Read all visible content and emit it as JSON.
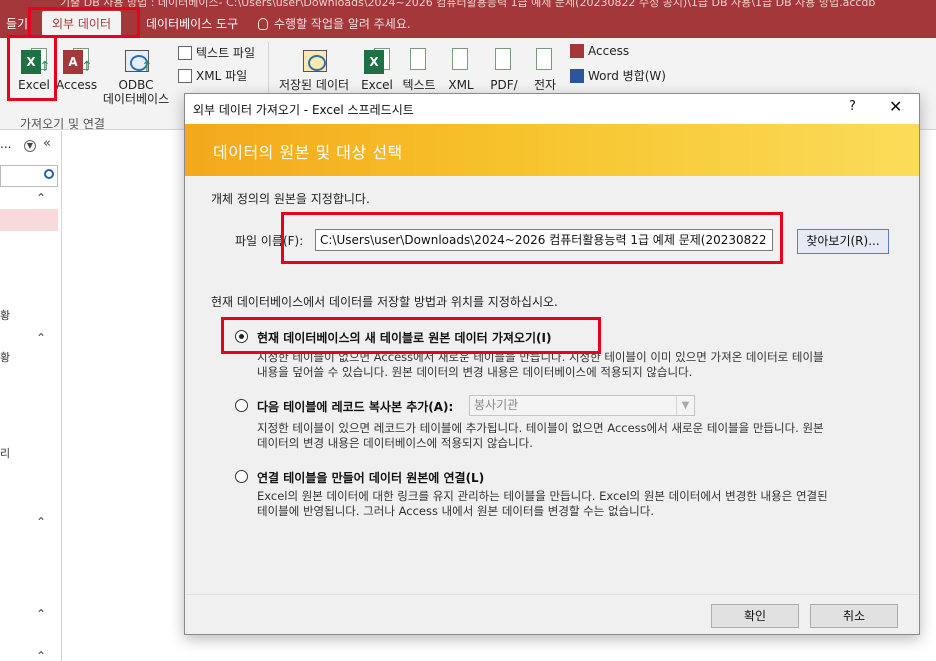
{
  "window": {
    "title_fragment": "기출 DB 사용 방법 : 데이터베이스- C:\\Users\\user\\Downloads\\2024~2026 컴퓨터활용능력 1급 예제 문제(20230822 수정 공지)\\1급 DB 사용\\1급 DB 사용 방법.accdb"
  },
  "ribbon": {
    "tabs": [
      {
        "label": "들기"
      },
      {
        "label": "외부 데이터"
      },
      {
        "label": "데이터베이스 도구"
      }
    ],
    "tell_me": "수행할 작업을 알려 주세요.",
    "import_group": {
      "label": "가져오기 및 연결",
      "excel": "Excel",
      "access": "Access",
      "odbc_line1": "ODBC",
      "odbc_line2": "데이터베이스",
      "text_file": "텍스트 파일",
      "xml_file": "XML 파일"
    },
    "export_group": {
      "saved": "저장된 데이터",
      "excel": "Excel",
      "text": "텍스트",
      "xml": "XML",
      "pdf": "PDF/",
      "email": "전자",
      "access": "Access",
      "word_merge": "Word 병합(W)"
    }
  },
  "nav": {
    "dots": "...",
    "collapse": "«",
    "chev": "⌃",
    "frag1": "황",
    "frag2": "황",
    "frag3": "리"
  },
  "dialog": {
    "title": "외부 데이터 가져오기 - Excel 스프레드시트",
    "help": "?",
    "close": "✕",
    "banner": "데이터의 원본 및 대상 선택",
    "specify_source": "개체 정의의 원본을 지정합니다.",
    "file_name_label": "파일 이름(F):",
    "file_path": "C:\\Users\\user\\Downloads\\2024~2026 컴퓨터활용능력 1급 예제 문제(20230822",
    "browse": "찾아보기(R)...",
    "specify_storage": "현재 데이터베이스에서 데이터를 저장할 방법과 위치를 지정하십시오.",
    "options": [
      {
        "label": "현재 데이터베이스의 새 테이블로 원본 데이터 가져오기(I)",
        "selected": true,
        "desc1": "지정한 테이블이 없으면 Access에서 새로운 테이블을 만듭니다. 지정한 테이블이 이미 있으면 가져온 데이터로 테이블",
        "desc2": "내용을 덮어쓸 수 있습니다. 원본 데이터의 변경 내용은 데이터베이스에 적용되지 않습니다."
      },
      {
        "label": "다음 테이블에 레코드 복사본 추가(A):",
        "selected": false,
        "combo_value": "봉사기관",
        "desc1": "지정한 테이블이 있으면 레코드가 테이블에 추가됩니다. 테이블이 없으면 Access에서 새로운 테이블을 만듭니다. 원본",
        "desc2": "데이터의 변경 내용은 데이터베이스에 적용되지 않습니다."
      },
      {
        "label": "연결 테이블을 만들어 데이터 원본에 연결(L)",
        "selected": false,
        "desc1": "Excel의 원본 데이터에 대한 링크를 유지 관리하는 테이블을 만듭니다. Excel의 원본 데이터에서 변경한 내용은 연결된",
        "desc2": "테이블에 반영됩니다. 그러나 Access 내에서 원본 데이터를 변경할 수는 없습니다."
      }
    ],
    "ok": "확인",
    "cancel": "취소"
  },
  "colors": {
    "accent": "#a4373a",
    "highlight": "#e8001c",
    "banner": "#f7c32c"
  }
}
